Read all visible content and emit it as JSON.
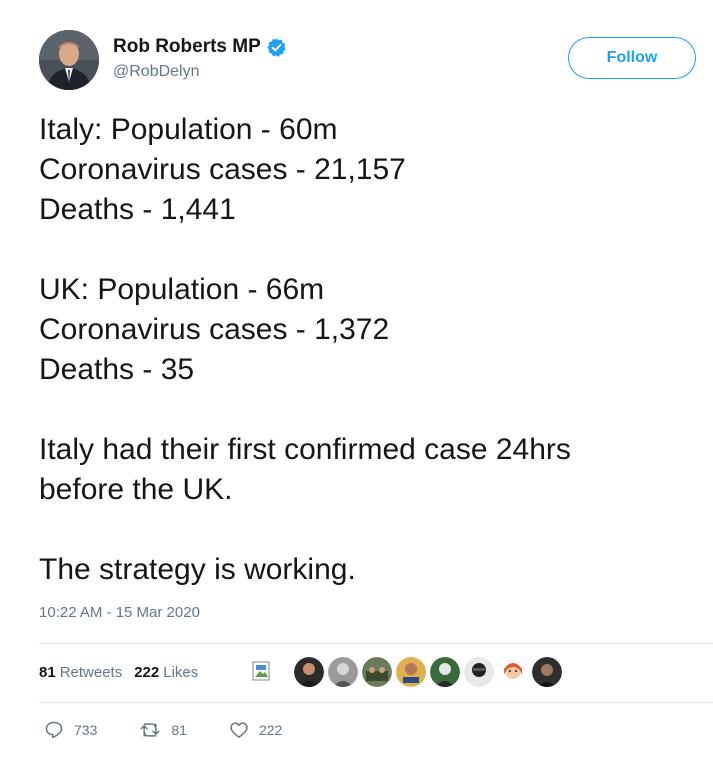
{
  "author": {
    "display_name": "Rob Roberts MP",
    "handle": "@RobDelyn",
    "verified": true
  },
  "follow_button": {
    "label": "Follow"
  },
  "tweet": {
    "lines": [
      "Italy: Population - 60m",
      "Coronavirus cases - 21,157",
      "Deaths - 1,441",
      "",
      "UK: Population - 66m",
      "Coronavirus cases - 1,372",
      "Deaths - 35",
      "",
      "Italy had their first confirmed case 24hrs",
      "before the UK.",
      "",
      "The strategy is working."
    ],
    "timestamp": "10:22 AM - 15 Mar 2020"
  },
  "stats": {
    "retweets_count": "81",
    "retweets_label": "Retweets",
    "likes_count": "222",
    "likes_label": "Likes"
  },
  "actions": {
    "reply_count": "733",
    "retweet_count": "81",
    "like_count": "222"
  },
  "colors": {
    "accent": "#1da1f2",
    "secondary_text": "#657786",
    "primary_text": "#14171a",
    "divider": "#e6ecf0"
  },
  "icons": [
    "verified-badge-icon",
    "broken-image-icon",
    "reply-icon",
    "retweet-icon",
    "like-icon"
  ]
}
